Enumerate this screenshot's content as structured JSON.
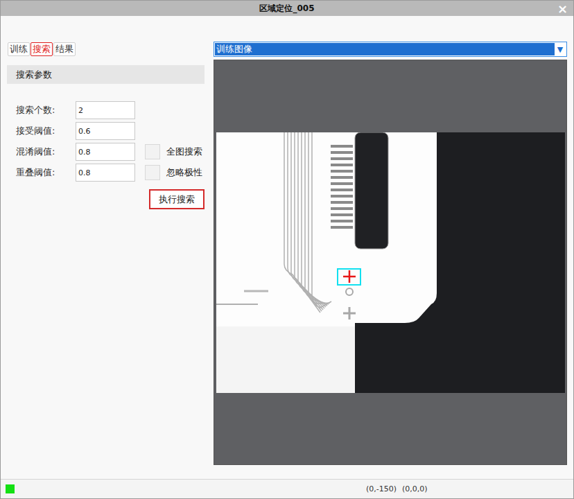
{
  "window": {
    "title": "区域定位_005",
    "close": "×"
  },
  "tabs": [
    {
      "label": "训练",
      "selected": false
    },
    {
      "label": "搜索",
      "selected": true
    },
    {
      "label": "结果",
      "selected": false
    }
  ],
  "section": {
    "title": "搜索参数"
  },
  "fields": [
    {
      "label": "搜索个数:",
      "value": "2"
    },
    {
      "label": "接受阈值:",
      "value": "0.6"
    },
    {
      "label": "混淆阈值:",
      "value": "0.8"
    },
    {
      "label": "重叠阈值:",
      "value": "0.8"
    }
  ],
  "checkboxes": [
    {
      "label": "全图搜索",
      "checked": false
    },
    {
      "label": "忽略极性",
      "checked": false
    }
  ],
  "button": "执行搜索",
  "image_select": {
    "value": "训练图像",
    "arrow": "▼"
  },
  "status_bar": {
    "ok": true,
    "coords": "(0,-150)",
    "value": "(0,0,0)"
  }
}
